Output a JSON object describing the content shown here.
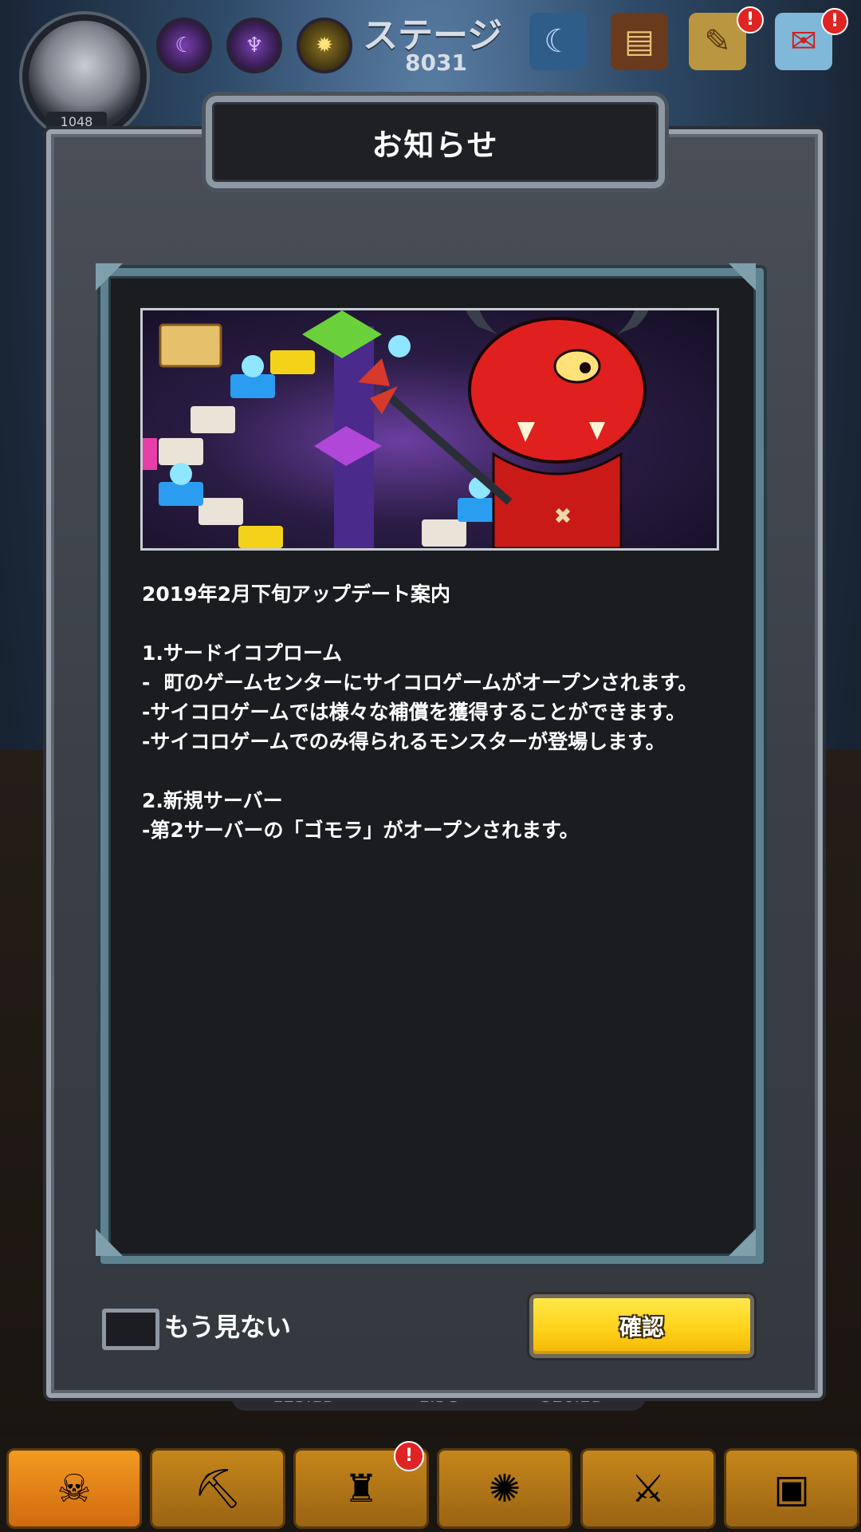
{
  "hud": {
    "player_level": "1048",
    "stage_label": "ステージ",
    "stage_number": "8031",
    "skills": [
      "dark-skill-icon",
      "demon-skill-icon",
      "sun-skill-icon"
    ],
    "top_icons": [
      "spellbook-icon",
      "monster-book-icon",
      "quest-scroll-icon",
      "mail-icon"
    ],
    "top_badge": "!"
  },
  "stats": {
    "attack": "125.1D",
    "defense": "1.3C",
    "gold": "526.2D"
  },
  "bottom_nav": {
    "items": [
      "skull-icon",
      "mine-cart-icon",
      "castle-icon",
      "emblem-icon",
      "shield-swords-icon",
      "chest-icon"
    ],
    "badge": "!"
  },
  "modal": {
    "title": "お知らせ",
    "lines": [
      "2019年2月下旬アップデート案内",
      "",
      "1.サードイコプローム",
      "-  町のゲームセンターにサイコロゲームがオープンされます。",
      "-サイコロゲームでは様々な補償を獲得することができます。",
      "-サイコロゲームでのみ得られるモンスターが登場します。",
      "",
      "2.新規サーバー",
      "-第2サーバーの「ゴモラ」がオープンされます。"
    ],
    "dont_show_label": "もう見ない",
    "confirm_label": "確認"
  },
  "colors": {
    "confirm": "#ffd21a",
    "frame": "#5f8290",
    "panel": "#3b4047",
    "badge": "#e02424"
  }
}
